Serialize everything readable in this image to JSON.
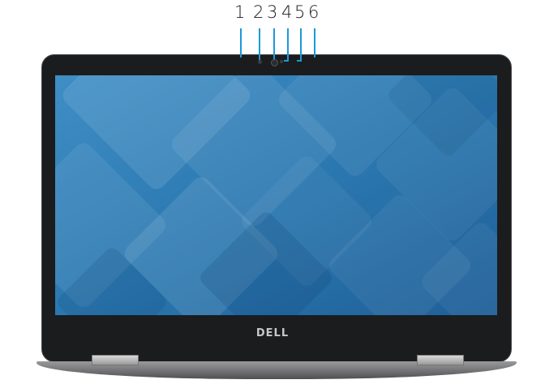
{
  "callouts": [
    "1",
    "2",
    "3",
    "4",
    "5",
    "6"
  ],
  "brand_logo": "DELL",
  "colors": {
    "callout_line": "#1a9ad9",
    "bezel": "#1b1c1e",
    "screen_base": "#2a79b2",
    "chassis": "#7a7a7c"
  }
}
